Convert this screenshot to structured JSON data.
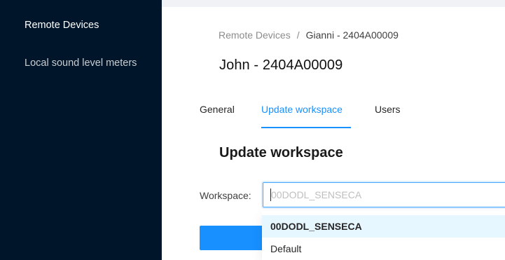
{
  "sidebar": {
    "items": [
      {
        "label": "Remote Devices"
      },
      {
        "label": "Local sound level meters"
      }
    ]
  },
  "breadcrumb": {
    "items": [
      "Remote Devices",
      "Gianni - 2404A00009"
    ],
    "separator": "/"
  },
  "page_title": "John - 2404A00009",
  "tabs": [
    {
      "label": "General"
    },
    {
      "label": "Update workspace",
      "active": true
    },
    {
      "label": "Users"
    }
  ],
  "section_title": "Update workspace",
  "workspace_field": {
    "label": "Workspace",
    "colon": ":",
    "placeholder": "00DODL_SENSECA"
  },
  "dropdown": {
    "options": [
      {
        "label": "00DODL_SENSECA",
        "selected": true
      },
      {
        "label": "Default",
        "selected": false
      }
    ]
  },
  "colors": {
    "sidebar_bg": "#001529",
    "accent": "#1890ff",
    "selected_option_bg": "#e6f7ff"
  }
}
